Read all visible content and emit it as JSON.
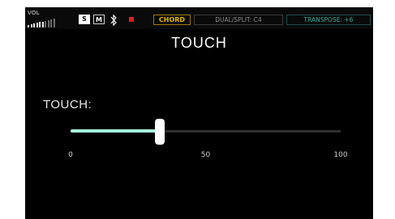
{
  "status_bar": {
    "vol_label": "VOL",
    "volume_level": 6,
    "mode_s": "S",
    "mode_m": "M",
    "bluetooth_icon": "bluetooth-icon",
    "record_indicator_color": "#e02020",
    "chord_label": "CHORD",
    "dual_split_label": "DUAL/SPLIT: C4",
    "transpose_label": "TRANSPOSE: +6"
  },
  "screen": {
    "title": "TOUCH",
    "param_label": "TOUCH:",
    "slider": {
      "value": 33,
      "min": 0,
      "max": 100,
      "fill_color": "#a9f3dd"
    },
    "tick_labels": [
      "0",
      "50",
      "100"
    ]
  }
}
